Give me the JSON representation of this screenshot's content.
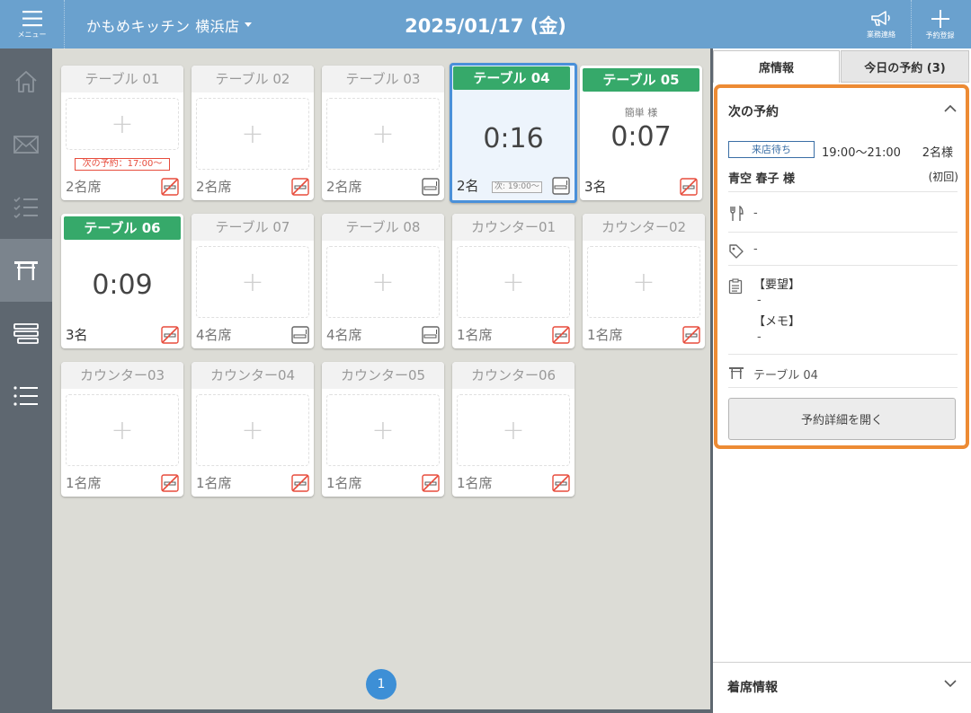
{
  "header": {
    "menu_label": "メニュー",
    "store_name": "かもめキッチン 横浜店",
    "date": "2025/01/17 (金)",
    "contact_label": "業務連絡",
    "reserve_label": "予約登録"
  },
  "sidebar": {
    "items": [
      {
        "icon": "home-icon"
      },
      {
        "icon": "mail-icon"
      },
      {
        "icon": "checklist-icon"
      },
      {
        "icon": "table-icon",
        "active": true
      },
      {
        "icon": "layers-icon"
      },
      {
        "icon": "list-icon"
      }
    ]
  },
  "tables": [
    {
      "name": "テーブル 01",
      "seats": "2名席",
      "next": "次の予約：17:00～",
      "smoking": "no-smoking"
    },
    {
      "name": "テーブル 02",
      "seats": "2名席",
      "smoking": "no-smoking"
    },
    {
      "name": "テーブル 03",
      "seats": "2名席",
      "smoking": "smoking"
    },
    {
      "name": "テーブル 04",
      "seats": "2名",
      "timer": "0:16",
      "next": "次: 19:00～",
      "smoking": "smoking"
    },
    {
      "name": "テーブル 05",
      "seats": "3名",
      "timer": "0:07",
      "guest": "簡単 様",
      "smoking": "no-smoking"
    },
    {
      "name": "テーブル 06",
      "seats": "3名",
      "timer": "0:09",
      "smoking": "no-smoking"
    },
    {
      "name": "テーブル 07",
      "seats": "4名席",
      "smoking": "smoking"
    },
    {
      "name": "テーブル 08",
      "seats": "4名席",
      "smoking": "smoking"
    },
    {
      "name": "カウンター01",
      "seats": "1名席",
      "smoking": "no-smoking"
    },
    {
      "name": "カウンター02",
      "seats": "1名席",
      "smoking": "no-smoking"
    },
    {
      "name": "カウンター03",
      "seats": "1名席",
      "smoking": "no-smoking"
    },
    {
      "name": "カウンター04",
      "seats": "1名席",
      "smoking": "no-smoking"
    },
    {
      "name": "カウンター05",
      "seats": "1名席",
      "smoking": "no-smoking"
    },
    {
      "name": "カウンター06",
      "seats": "1名席",
      "smoking": "no-smoking"
    }
  ],
  "pager": {
    "current": "1"
  },
  "panel": {
    "tab_seat": "席情報",
    "tab_today": "今日の予約 (3)",
    "next": {
      "title": "次の予約",
      "status": "来店待ち",
      "time": "19:00～21:00",
      "count": "2名様",
      "name": "青空 春子 様",
      "visit": "(初回)",
      "course": "-",
      "tag": "-",
      "request_label": "【要望】",
      "request_value": "-",
      "memo_label": "【メモ】",
      "memo_value": "-",
      "table": "テーブル 04",
      "open_button": "予約詳細を開く"
    },
    "seat_info_title": "着席情報"
  },
  "colors": {
    "header": "#6aa1ce",
    "occupied": "#36a96a",
    "selected_border": "#4a90d9",
    "highlight": "#ed8b34",
    "alert": "#e74c3c"
  }
}
